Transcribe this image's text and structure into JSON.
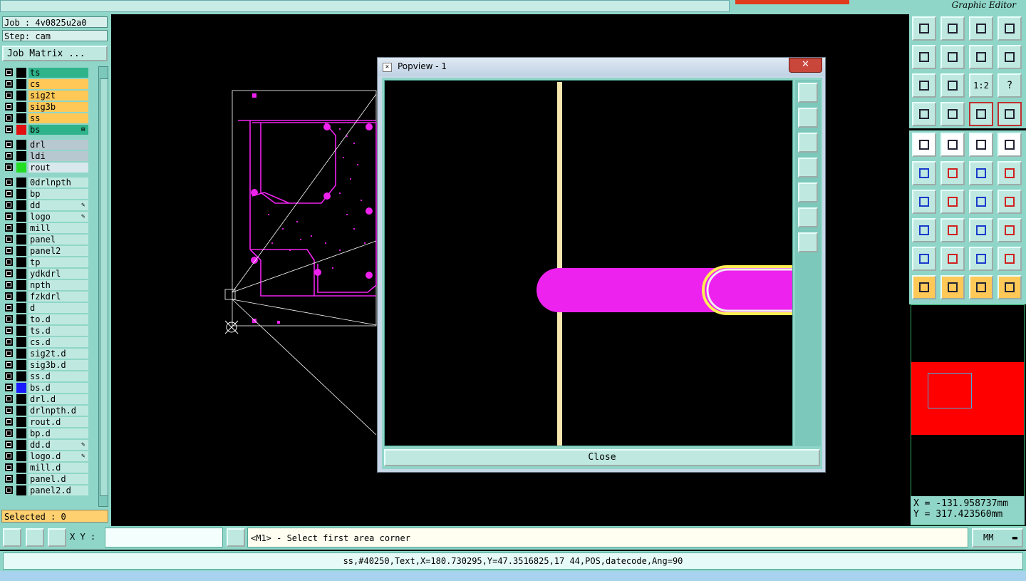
{
  "app": {
    "brand": "Graphic Editor"
  },
  "left": {
    "job": "Job : 4v0825u2a0",
    "step": "Step: cam",
    "job_matrix_label": "Job Matrix ...",
    "selected": "Selected : 0",
    "layers": [
      {
        "name": "ts",
        "bg": "#2fb38a",
        "swatch": "#000"
      },
      {
        "name": "cs",
        "bg": "#ffc857",
        "swatch": "#000"
      },
      {
        "name": "sig2t",
        "bg": "#ffc857",
        "swatch": "#000"
      },
      {
        "name": "sig3b",
        "bg": "#ffc857",
        "swatch": "#000"
      },
      {
        "name": "ss",
        "bg": "#ffc857",
        "swatch": "#000"
      },
      {
        "name": "bs",
        "bg": "#2fb38a",
        "swatch": "#e01010",
        "mark": "⊞"
      },
      {
        "name": "drl",
        "bg": "#b8c8d0",
        "swatch": "#000"
      },
      {
        "name": "ldi",
        "bg": "#b8c8d0",
        "swatch": "#000"
      },
      {
        "name": "rout",
        "bg": "#d8e8ec",
        "swatch": "#22dd22"
      },
      {
        "name": "0drlnpth",
        "bg": "#bfe9e0",
        "swatch": "#000"
      },
      {
        "name": "bp",
        "bg": "#bfe9e0",
        "swatch": "#000"
      },
      {
        "name": "dd",
        "bg": "#bfe9e0",
        "swatch": "#000",
        "mark": "✎"
      },
      {
        "name": "logo",
        "bg": "#bfe9e0",
        "swatch": "#000",
        "mark": "✎"
      },
      {
        "name": "mill",
        "bg": "#bfe9e0",
        "swatch": "#000"
      },
      {
        "name": "panel",
        "bg": "#bfe9e0",
        "swatch": "#000"
      },
      {
        "name": "panel2",
        "bg": "#bfe9e0",
        "swatch": "#000"
      },
      {
        "name": "tp",
        "bg": "#bfe9e0",
        "swatch": "#000"
      },
      {
        "name": "ydkdrl",
        "bg": "#bfe9e0",
        "swatch": "#000"
      },
      {
        "name": "npth",
        "bg": "#bfe9e0",
        "swatch": "#000"
      },
      {
        "name": "fzkdrl",
        "bg": "#bfe9e0",
        "swatch": "#000"
      },
      {
        "name": "d",
        "bg": "#bfe9e0",
        "swatch": "#000"
      },
      {
        "name": "to.d",
        "bg": "#bfe9e0",
        "swatch": "#000"
      },
      {
        "name": "ts.d",
        "bg": "#bfe9e0",
        "swatch": "#000"
      },
      {
        "name": "cs.d",
        "bg": "#bfe9e0",
        "swatch": "#000"
      },
      {
        "name": "sig2t.d",
        "bg": "#bfe9e0",
        "swatch": "#000"
      },
      {
        "name": "sig3b.d",
        "bg": "#bfe9e0",
        "swatch": "#000"
      },
      {
        "name": "ss.d",
        "bg": "#bfe9e0",
        "swatch": "#000"
      },
      {
        "name": "bs.d",
        "bg": "#bfe9e0",
        "swatch": "#1a1aff"
      },
      {
        "name": "drl.d",
        "bg": "#bfe9e0",
        "swatch": "#000"
      },
      {
        "name": "drlnpth.d",
        "bg": "#bfe9e0",
        "swatch": "#000"
      },
      {
        "name": "rout.d",
        "bg": "#bfe9e0",
        "swatch": "#000"
      },
      {
        "name": "bp.d",
        "bg": "#bfe9e0",
        "swatch": "#000"
      },
      {
        "name": "dd.d",
        "bg": "#bfe9e0",
        "swatch": "#000",
        "mark": "✎"
      },
      {
        "name": "logo.d",
        "bg": "#bfe9e0",
        "swatch": "#000",
        "mark": "✎"
      },
      {
        "name": "mill.d",
        "bg": "#bfe9e0",
        "swatch": "#000"
      },
      {
        "name": "panel.d",
        "bg": "#bfe9e0",
        "swatch": "#000"
      },
      {
        "name": "panel2.d",
        "bg": "#bfe9e0",
        "swatch": "#000"
      }
    ]
  },
  "right": {
    "coord_x": "X = -131.958737mm",
    "coord_y": "Y = 317.423560mm",
    "top_toolbar_labels": {
      "zoom_ratio": "1:2",
      "help": "?"
    }
  },
  "popup": {
    "title": "Popview - 1",
    "close_x": "✕",
    "close_button": "Close"
  },
  "bottom": {
    "xy_label": "X Y :",
    "xy_value": "",
    "prompt": "<M1> - Select first area corner",
    "units": "MM",
    "status": "ss,#40250,Text,X=180.730295,Y=47.3516825,17 44,POS,datecode,Ang=90"
  },
  "colors": {
    "panel": "#8fd6c8",
    "pad": "#ee22ee",
    "highlight": "#ffee55",
    "trace": "#f5e6b0"
  }
}
